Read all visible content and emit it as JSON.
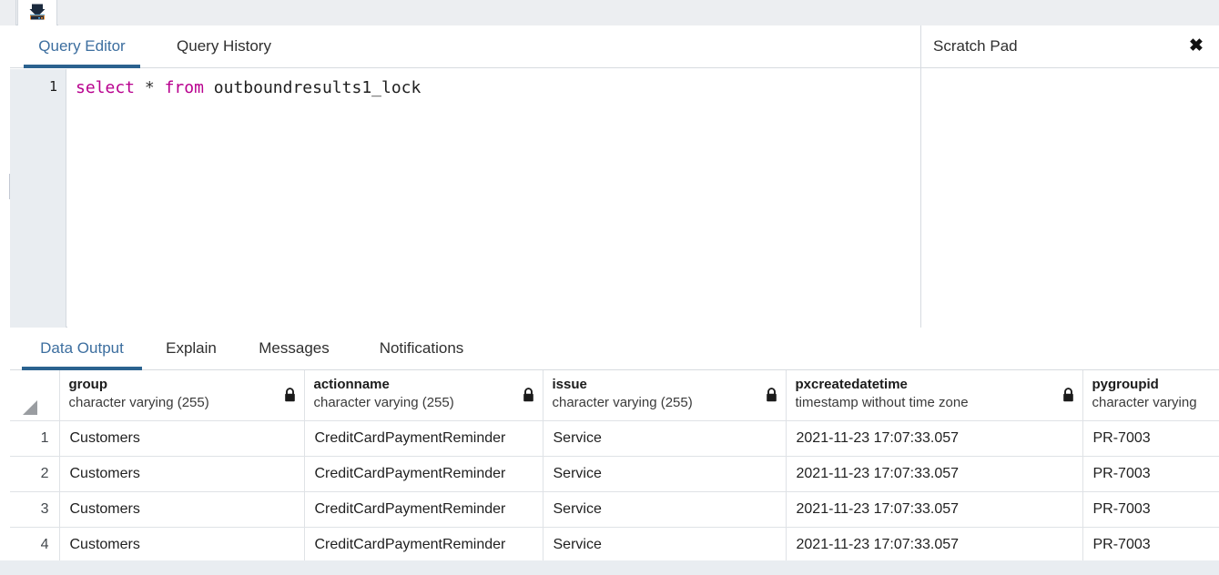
{
  "toolbar": {
    "download_icon": "download-results-icon"
  },
  "editor_panel": {
    "tabs": [
      {
        "id": "query-editor",
        "label": "Query Editor",
        "active": true
      },
      {
        "id": "query-history",
        "label": "Query History",
        "active": false
      }
    ],
    "line_number": "1",
    "query": {
      "keyword1": "select",
      "star": "*",
      "keyword2": "from",
      "table": "outboundresults1_lock",
      "full_text": "select * from outboundresults1_lock"
    }
  },
  "scratch_pad": {
    "title": "Scratch Pad",
    "close_icon": "close-icon",
    "close_glyph": "✖",
    "content": ""
  },
  "results_panel": {
    "tabs": [
      {
        "id": "data-output",
        "label": "Data Output",
        "active": true
      },
      {
        "id": "explain",
        "label": "Explain",
        "active": false
      },
      {
        "id": "messages",
        "label": "Messages",
        "active": false
      },
      {
        "id": "notifications",
        "label": "Notifications",
        "active": false
      }
    ],
    "grid": {
      "columns": [
        {
          "name": "group",
          "type": "character varying (255)",
          "locked": true
        },
        {
          "name": "actionname",
          "type": "character varying (255)",
          "locked": true
        },
        {
          "name": "issue",
          "type": "character varying (255)",
          "locked": true
        },
        {
          "name": "pxcreatedatetime",
          "type": "timestamp without time zone",
          "locked": true
        },
        {
          "name": "pygroupid",
          "type": "character varying",
          "locked": false
        }
      ],
      "rows": [
        {
          "num": "1",
          "group": "Customers",
          "actionname": "CreditCardPaymentReminder",
          "issue": "Service",
          "pxcreatedatetime": "2021-11-23 17:07:33.057",
          "pygroupid": "PR-7003"
        },
        {
          "num": "2",
          "group": "Customers",
          "actionname": "CreditCardPaymentReminder",
          "issue": "Service",
          "pxcreatedatetime": "2021-11-23 17:07:33.057",
          "pygroupid": "PR-7003"
        },
        {
          "num": "3",
          "group": "Customers",
          "actionname": "CreditCardPaymentReminder",
          "issue": "Service",
          "pxcreatedatetime": "2021-11-23 17:07:33.057",
          "pygroupid": "PR-7003"
        },
        {
          "num": "4",
          "group": "Customers",
          "actionname": "CreditCardPaymentReminder",
          "issue": "Service",
          "pxcreatedatetime": "2021-11-23 17:07:33.057",
          "pygroupid": "PR-7003"
        }
      ]
    }
  },
  "colors": {
    "accent_blue": "#2b628f",
    "tab_active_text": "#3c6e9f",
    "sql_keyword": "#b8008e",
    "panel_bg": "#eceef1",
    "gutter_bg": "#e9edf1",
    "border": "#dfe2e6"
  }
}
